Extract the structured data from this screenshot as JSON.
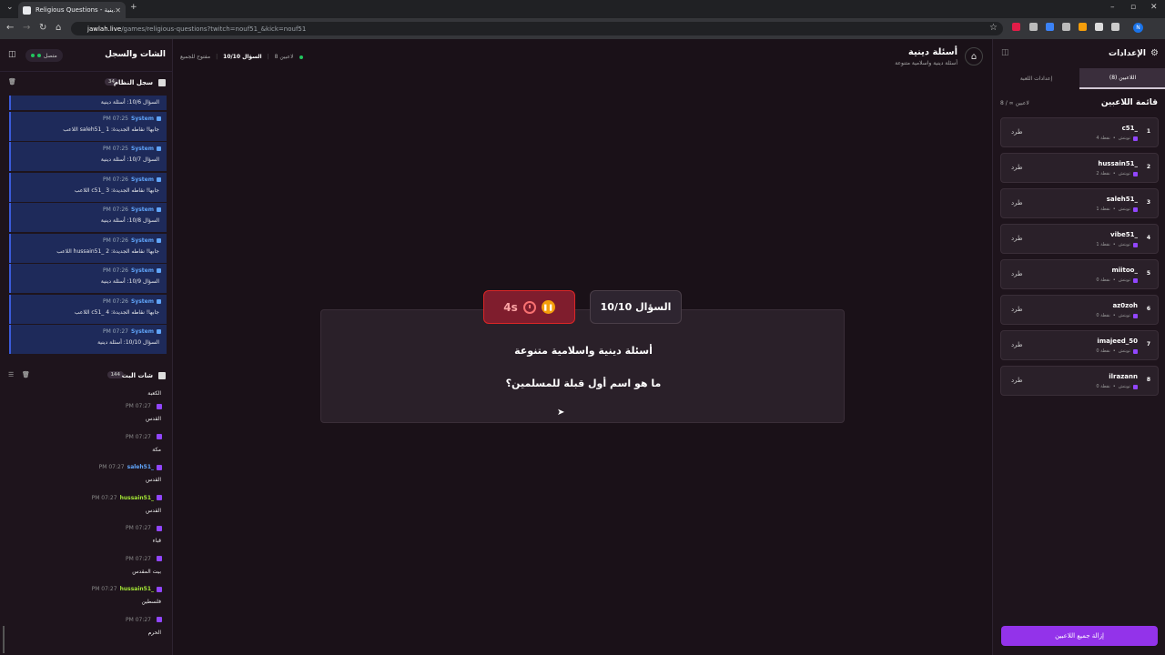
{
  "browser": {
    "tab_title": "Religious Questions - أسئلة دينية",
    "url_host": "jawlah.live",
    "url_path": "/games/religious-questions?twitch=nouf51_&kick=nouf51"
  },
  "left": {
    "title": "الشات والسجل",
    "status": "متصل",
    "system_log": {
      "label": "سجل النظام",
      "count": "34",
      "items": [
        {
          "time": "",
          "sender": "",
          "msg": "السؤال 10/6: أسئلة دينية"
        },
        {
          "time": "PM 07:25",
          "sender": "System",
          "msg": "اللاعب saleh51_ جابها! نقاطه الجديدة: 1"
        },
        {
          "time": "PM 07:25",
          "sender": "System",
          "msg": "السؤال 10/7: أسئلة دينية"
        },
        {
          "time": "PM 07:26",
          "sender": "System",
          "msg": "اللاعب c51_ جابها! نقاطه الجديدة: 3"
        },
        {
          "time": "PM 07:26",
          "sender": "System",
          "msg": "السؤال 10/8: أسئلة دينية"
        },
        {
          "time": "PM 07:26",
          "sender": "System",
          "msg": "اللاعب hussain51_ جابها! نقاطه الجديدة: 2"
        },
        {
          "time": "PM 07:26",
          "sender": "System",
          "msg": "السؤال 10/9: أسئلة دينية"
        },
        {
          "time": "PM 07:26",
          "sender": "System",
          "msg": "اللاعب c51_ جابها! نقاطه الجديدة: 4"
        },
        {
          "time": "PM 07:27",
          "sender": "System",
          "msg": "السؤال 10/10: أسئلة دينية"
        }
      ]
    },
    "stream_chat": {
      "label": "شات البث",
      "count": "144",
      "items": [
        {
          "time": "",
          "user": "",
          "color": "#9ca3af",
          "msg": "الكعبة"
        },
        {
          "time": "PM 07:27",
          "user": "",
          "color": "#dc2626",
          "msg": "القدس"
        },
        {
          "time": "PM 07:27",
          "user": "",
          "color": "#2563eb",
          "msg": "مكة"
        },
        {
          "time": "PM 07:27",
          "user": "saleh51_",
          "color": "#60a5fa",
          "msg": "القدس"
        },
        {
          "time": "PM 07:27",
          "user": "hussain51_",
          "color": "#a3e635",
          "msg": "القدس"
        },
        {
          "time": "PM 07:27",
          "user": "",
          "color": "#dc2626",
          "msg": "قباء"
        },
        {
          "time": "PM 07:27",
          "user": "",
          "color": "#dc2626",
          "msg": "بيت المقدس"
        },
        {
          "time": "PM 07:27",
          "user": "hussain51_",
          "color": "#a3e635",
          "msg": "فلسطين"
        },
        {
          "time": "PM 07:27",
          "user": "",
          "color": "#2563eb",
          "msg": "الحرم"
        }
      ]
    }
  },
  "main": {
    "title": "أسئلة دينية",
    "subtitle": "أسئلة دينية واسلامية متنوعة",
    "players_online": "8 لاعبين",
    "question_status": "السؤال 10/10",
    "open_status": "مفتوح للجميع",
    "question_number": "السؤال 10/10",
    "timer": "4s",
    "category": "أسئلة دينية واسلامية متنوعة",
    "question": "ما هو اسم أول قبلة للمسلمين؟"
  },
  "right": {
    "title": "الإعدادات",
    "tab_players": "اللاعبين (8)",
    "tab_settings": "إعدادات اللعبة",
    "list_title": "قائمة اللاعبين",
    "count_text": "8 / ∞ لاعبين",
    "kick_label": "طرد",
    "players": [
      {
        "rank": "1",
        "name": "c51_",
        "points": "4 نقطة"
      },
      {
        "rank": "2",
        "name": "hussain51_",
        "points": "2 نقطة"
      },
      {
        "rank": "3",
        "name": "saleh51_",
        "points": "1 نقطة"
      },
      {
        "rank": "4",
        "name": "vibe51_",
        "points": "1 نقطة"
      },
      {
        "rank": "5",
        "name": "miitoo_",
        "points": "0 نقطة"
      },
      {
        "rank": "6",
        "name": "az0zoh",
        "points": "0 نقطة"
      },
      {
        "rank": "7",
        "name": "imajeed_50",
        "points": "0 نقطة"
      },
      {
        "rank": "8",
        "name": "ilrazann",
        "points": "0 نقطة"
      }
    ],
    "platform": "تويتش",
    "clear_button": "إزالة جميع اللاعبين"
  }
}
